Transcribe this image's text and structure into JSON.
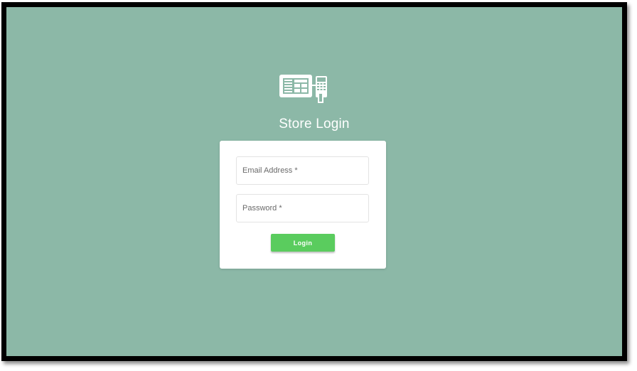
{
  "app": {
    "logo_icon": "pos-terminal-icon",
    "title": "Store Login"
  },
  "form": {
    "email": {
      "placeholder": "Email Address *",
      "value": ""
    },
    "password": {
      "placeholder": "Password *",
      "value": ""
    },
    "login_label": "Login"
  },
  "colors": {
    "background": "#8cb8a7",
    "card": "#ffffff",
    "button": "#5acc5e",
    "frame_border": "#000000"
  }
}
